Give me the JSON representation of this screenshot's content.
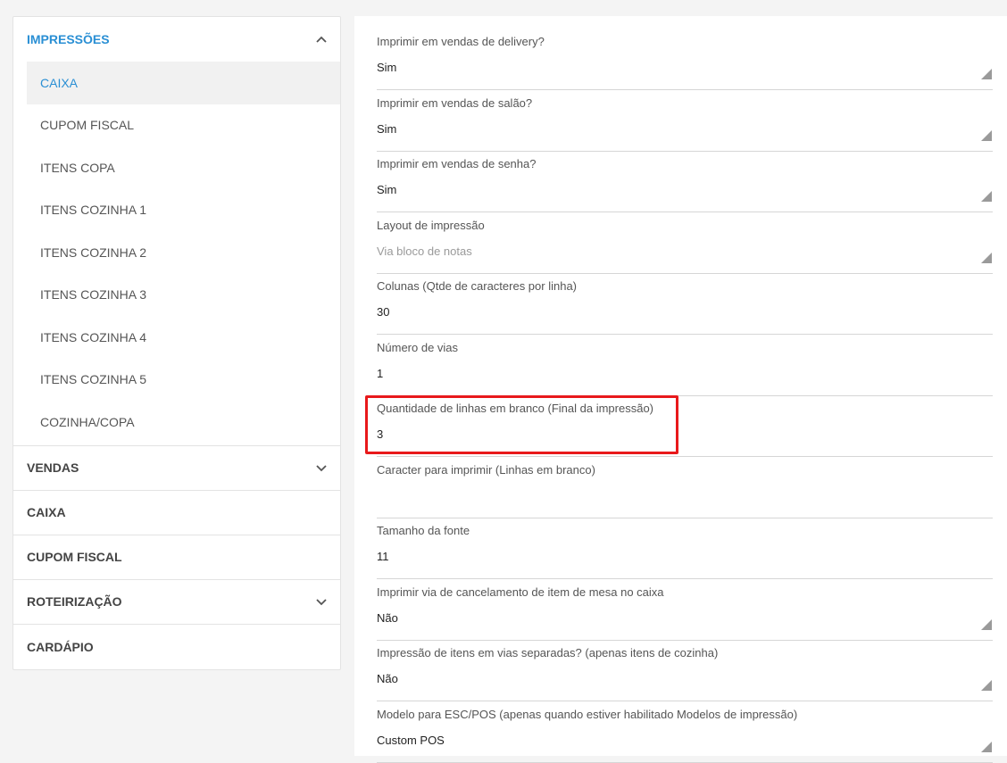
{
  "sidebar": {
    "impressoes": {
      "label": "IMPRESSÕES",
      "items": [
        "CAIXA",
        "CUPOM FISCAL",
        "ITENS COPA",
        "ITENS COZINHA 1",
        "ITENS COZINHA 2",
        "ITENS COZINHA 3",
        "ITENS COZINHA 4",
        "ITENS COZINHA 5",
        "COZINHA/COPA"
      ]
    },
    "groups": [
      "VENDAS",
      "CAIXA",
      "CUPOM FISCAL",
      "ROTEIRIZAÇÃO",
      "CARDÁPIO"
    ]
  },
  "fields": [
    {
      "label": "Imprimir em vendas de delivery?",
      "value": "Sim",
      "select": true
    },
    {
      "label": "Imprimir em vendas de salão?",
      "value": "Sim",
      "select": true
    },
    {
      "label": "Imprimir em vendas de senha?",
      "value": "Sim",
      "select": true
    },
    {
      "label": "Layout de impressão",
      "value": "Via bloco de notas",
      "select": true,
      "placeholder": true
    },
    {
      "label": "Colunas (Qtde de caracteres por linha)",
      "value": "30"
    },
    {
      "label": "Número de vias",
      "value": "1"
    },
    {
      "label": "Quantidade de linhas em branco (Final da impressão)",
      "value": "3"
    },
    {
      "label": "Caracter para imprimir (Linhas em branco)",
      "value": ""
    },
    {
      "label": "Tamanho da fonte",
      "value": "11"
    },
    {
      "label": "Imprimir via de cancelamento de item de mesa no caixa",
      "value": "Não",
      "select": true
    },
    {
      "label": "Impressão de itens em vias separadas? (apenas itens de cozinha)",
      "value": "Não",
      "select": true
    },
    {
      "label": "Modelo para ESC/POS (apenas quando estiver habilitado Modelos de impressão)",
      "value": "Custom POS",
      "select": true
    }
  ],
  "colors": {
    "accent": "#2a8fd4",
    "highlight": "#e8191b"
  }
}
